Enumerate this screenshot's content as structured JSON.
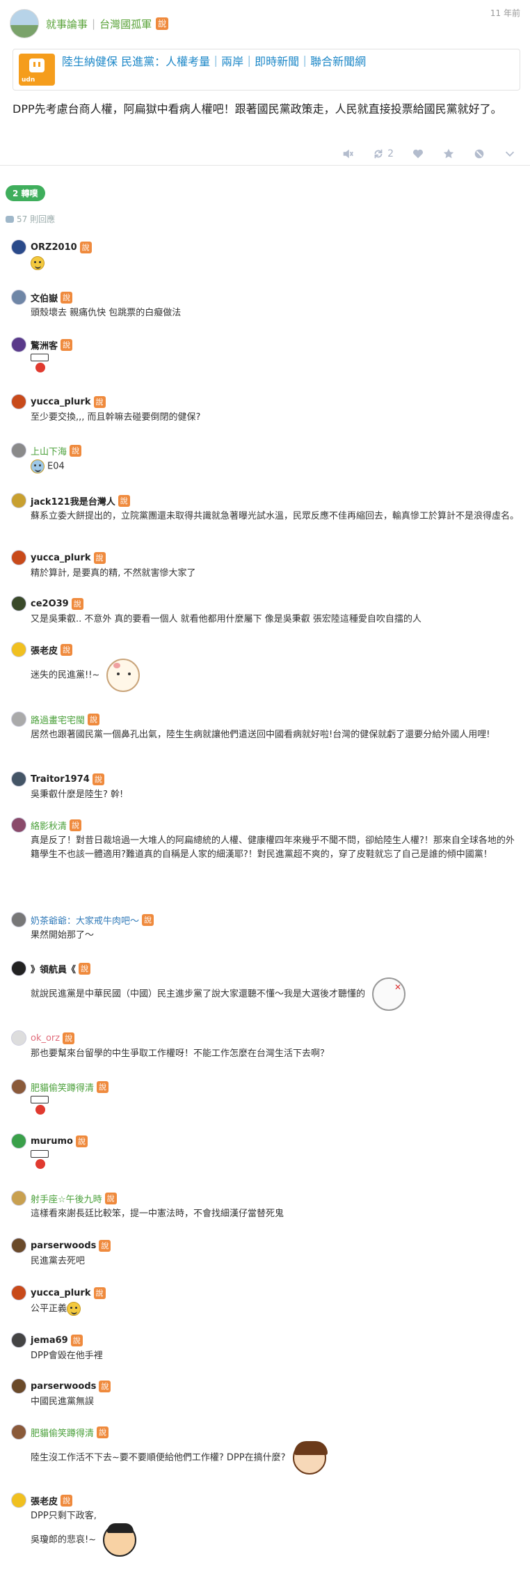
{
  "post": {
    "author": "就事論事",
    "group": "台灣國孤軍",
    "badge": "說",
    "time": "11 年前",
    "link_title": "陸生納健保 民進黨：人權考量｜兩岸｜即時新聞｜聯合新聞網",
    "link_logo_text": "udn",
    "body": "DPP先考慮台商人權，阿扁獄中看病人權吧！跟著國民黨政策走，人民就直接投票給國民黨就好了。",
    "actions": {
      "mute_icon": "mute-icon",
      "replurk_icon": "replurk-icon",
      "replurk_count": "2",
      "like_icon": "heart-icon",
      "favorite_icon": "star-icon",
      "block_icon": "block-icon",
      "more_icon": "chevron-down-icon"
    }
  },
  "replurks_pill": "2 轉噗",
  "reply_count": "57 則回應",
  "responses": [
    {
      "name": "ORZ2010",
      "style": "",
      "avatar_color": "#2a4a8a",
      "text": "",
      "emoji": "face"
    },
    {
      "name": "文伯嶽",
      "style": "",
      "avatar_color": "#6f86a6",
      "text": "頭殼壞去 親痛仇快 包跳票的白癡做法",
      "emoji": ""
    },
    {
      "name": "驚洲客",
      "style": "",
      "avatar_color": "#5a3a8a",
      "text": "",
      "emoji": "stamp"
    },
    {
      "name": "yucca_plurk",
      "style": "",
      "avatar_color": "#c84a1a",
      "text": "至少要交換,,, 而且幹嘛去碰要倒閉的健保?",
      "emoji": ""
    },
    {
      "name": "上山下海",
      "style": "green",
      "avatar_color": "#8a8a8a",
      "text": "E04",
      "emoji": "face2"
    },
    {
      "name": "jack121我是台灣人",
      "style": "",
      "avatar_color": "#c8a030",
      "text": "蘇系立委大餅提出的，立院黨團還未取得共識就急著曝光試水溫，民眾反應不佳再縮回去，輸真慘工於算計不是浪得虛名。",
      "emoji": ""
    },
    {
      "name": "yucca_plurk",
      "style": "",
      "avatar_color": "#c84a1a",
      "text": "精於算計, 是要真的精, 不然就害慘大家了",
      "emoji": ""
    },
    {
      "name": "ce2O39",
      "style": "",
      "avatar_color": "#3a4a2a",
      "text": "又是吳秉叡.. 不意外 真的要看一個人 就看他都用什麼屬下 像是吳秉叡 張宏陸這種愛自吹自擂的人",
      "emoji": ""
    },
    {
      "name": "張老皮",
      "style": "",
      "avatar_color": "#f0c020",
      "text": "迷失的民進黨!!~",
      "emoji": "cat"
    },
    {
      "name": "路過畫宅宅閩",
      "style": "green",
      "avatar_color": "#aaaaaa",
      "text": "居然也跟著國民黨一個鼻孔出氣，陸生生病就讓他們遣送回中國看病就好啦!台灣的健保就虧了還要分給外國人用哩!",
      "emoji": ""
    },
    {
      "name": "Traitor1974",
      "style": "",
      "avatar_color": "#445566",
      "text": "吳秉叡什麼是陸生? 幹!",
      "emoji": ""
    },
    {
      "name": "絡影秋清",
      "style": "green",
      "avatar_color": "#8a4a6a",
      "text": "真是反了！對昔日裁培過一大堆人的阿扁總統的人權、健康權四年來幾乎不聞不問，卻給陸生人權?！那來自全球各地的外籍學生不也該一體適用?難道真的自稱是人家的細漢耶?！對民進黨超不爽的，穿了皮鞋就忘了自己是誰的傾中國黨！",
      "emoji": ""
    },
    {
      "name": "奶茶爺爺：大家戒牛肉吧～",
      "style": "blue",
      "avatar_color": "#777777",
      "text": "果然開始那了～",
      "emoji": ""
    },
    {
      "name": "》領航員《",
      "style": "",
      "avatar_color": "#222222",
      "text": "就說民進黨是中華民國（中國）民主進步黨了說大家還聽不懂～我是大選後才聽懂的",
      "emoji": "cat2"
    },
    {
      "name": "ok_orz",
      "style": "pink",
      "avatar_color": "#dddddd",
      "text": "那也要幫來台留學的中生爭取工作權呀！不能工作怎麼在台灣生活下去啊？",
      "emoji": ""
    },
    {
      "name": "肥貓偷笑蹲得清",
      "style": "green",
      "avatar_color": "#8a5a3a",
      "text": "",
      "emoji": "stamp"
    },
    {
      "name": "murumo",
      "style": "",
      "avatar_color": "#3aa04a",
      "text": "",
      "emoji": "stamp"
    },
    {
      "name": "射手座☆午後九時",
      "style": "green",
      "avatar_color": "#c8a050",
      "text": "這樣看來謝長廷比較笨，提一中憲法時，不會找細漢仔當替死鬼",
      "emoji": ""
    },
    {
      "name": "parserwoods",
      "style": "",
      "avatar_color": "#6a4a2a",
      "text": "民進黨去死吧",
      "emoji": ""
    },
    {
      "name": "yucca_plurk",
      "style": "",
      "avatar_color": "#c84a1a",
      "text": "公平正義",
      "emoji": "face"
    },
    {
      "name": "jema69",
      "style": "",
      "avatar_color": "#444444",
      "text": "DPP會毀在他手裡",
      "emoji": ""
    },
    {
      "name": "parserwoods",
      "style": "",
      "avatar_color": "#6a4a2a",
      "text": "中國民進黨無誤",
      "emoji": ""
    },
    {
      "name": "肥貓偷笑蹲得清",
      "style": "green",
      "avatar_color": "#8a5a3a",
      "text": "陸生沒工作活不下去~要不要順便給他們工作權? DPP在搞什麼?",
      "emoji": "girl"
    },
    {
      "name": "張老皮",
      "style": "",
      "avatar_color": "#f0c020",
      "text": "DPP只剩下政客,\n吳瓊郎的悲哀!~",
      "emoji": "boy"
    }
  ]
}
